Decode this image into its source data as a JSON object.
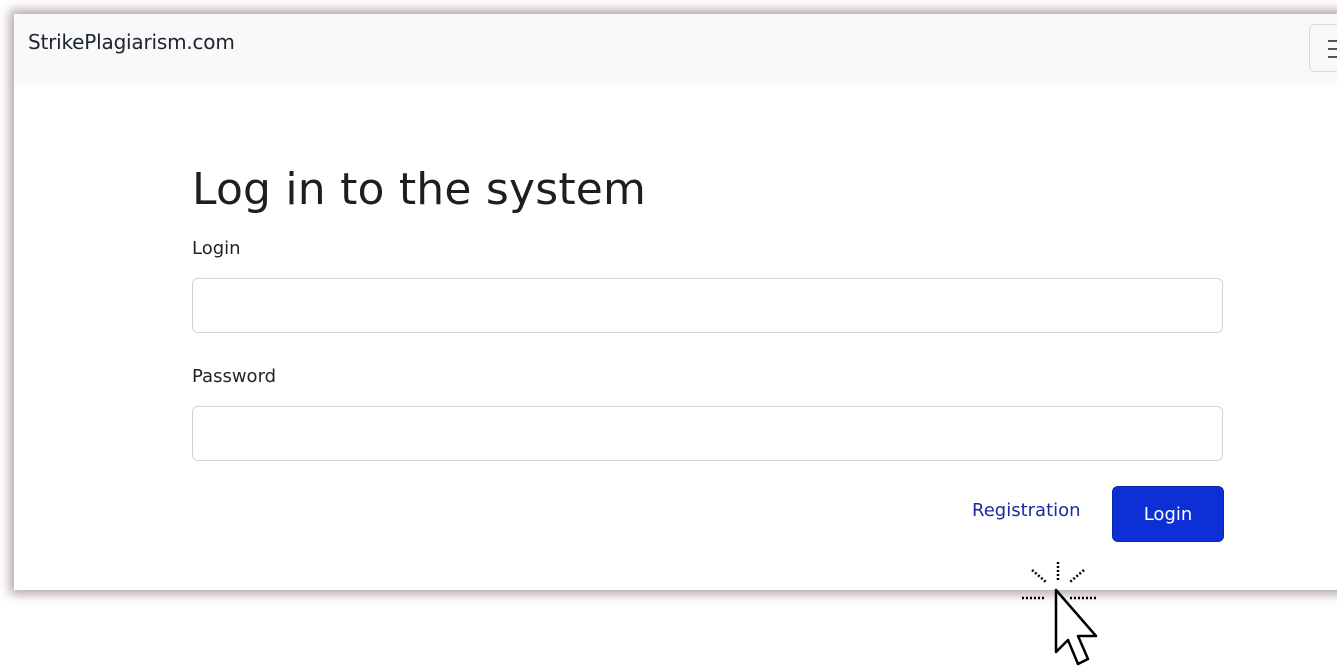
{
  "navbar": {
    "brand": "StrikePlagiarism.com",
    "toggler_icon": "menu-icon"
  },
  "form": {
    "title": "Log in to the system",
    "login_label": "Login",
    "login_value": "",
    "password_label": "Password",
    "password_value": "",
    "registration_link": "Registration",
    "login_button": "Login"
  },
  "colors": {
    "navbar_bg": "#f8f9fa",
    "primary": "#0d2fd6",
    "link": "#1a2aa0",
    "window_shadow": "#785555"
  },
  "cursor": {
    "icon": "click-cursor-icon"
  }
}
